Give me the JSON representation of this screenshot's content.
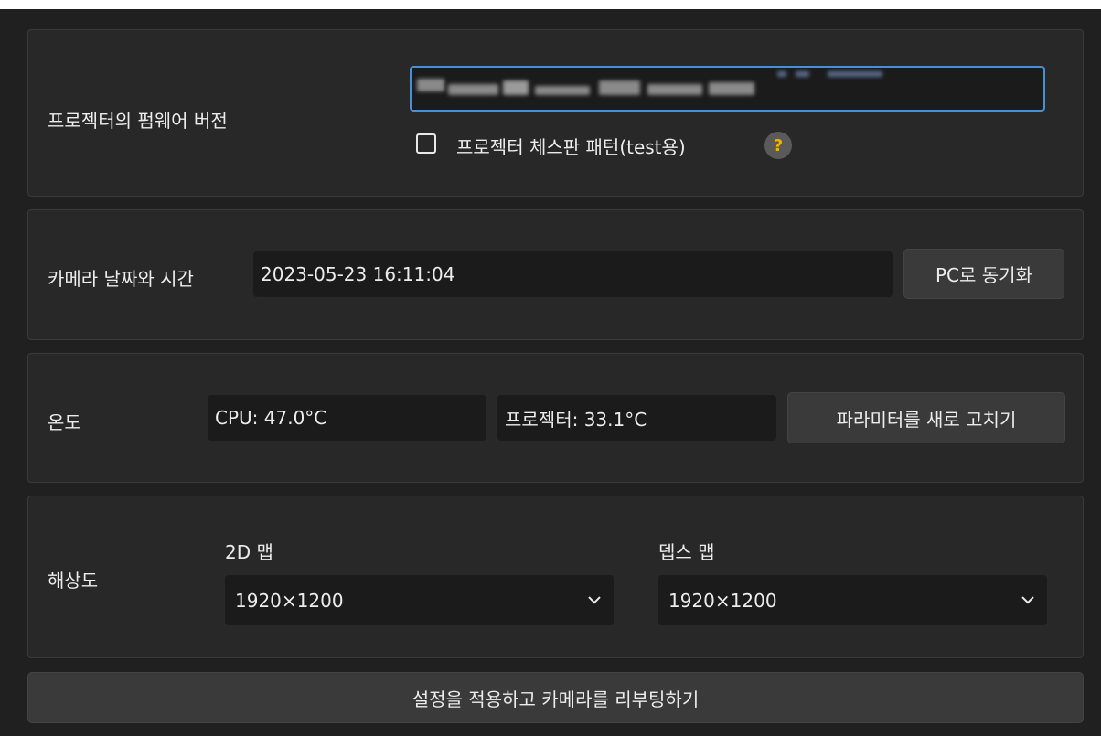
{
  "firmware": {
    "label": "프로젝터의 펌웨어 버전",
    "value": "",
    "checkbox_label": "프로젝터 체스판 패턴(test용)",
    "checkbox_checked": false,
    "help_glyph": "?"
  },
  "datetime": {
    "label": "카메라 날짜와 시간",
    "value": "2023-05-23 16:11:04",
    "sync_button": "PC로 동기화"
  },
  "temperature": {
    "label": "온도",
    "cpu": "CPU: 47.0°C",
    "projector": "프로젝터: 33.1°C",
    "refresh_button": "파라미터를 새로 고치기"
  },
  "resolution": {
    "label": "해상도",
    "map2d_label": "2D 맵",
    "map2d_value": "1920×1200",
    "depth_label": "뎁스 맵",
    "depth_value": "1920×1200"
  },
  "apply_button": "설정을 적용하고 카메라를 리부팅하기",
  "icons": {
    "checkbox": "checkbox-icon",
    "help": "help-icon",
    "dropdown": "chevron-down-icon"
  },
  "colors": {
    "background": "#202020",
    "panel": "#282828",
    "focus": "#4a8ed6",
    "help_accent": "#f0b400"
  }
}
